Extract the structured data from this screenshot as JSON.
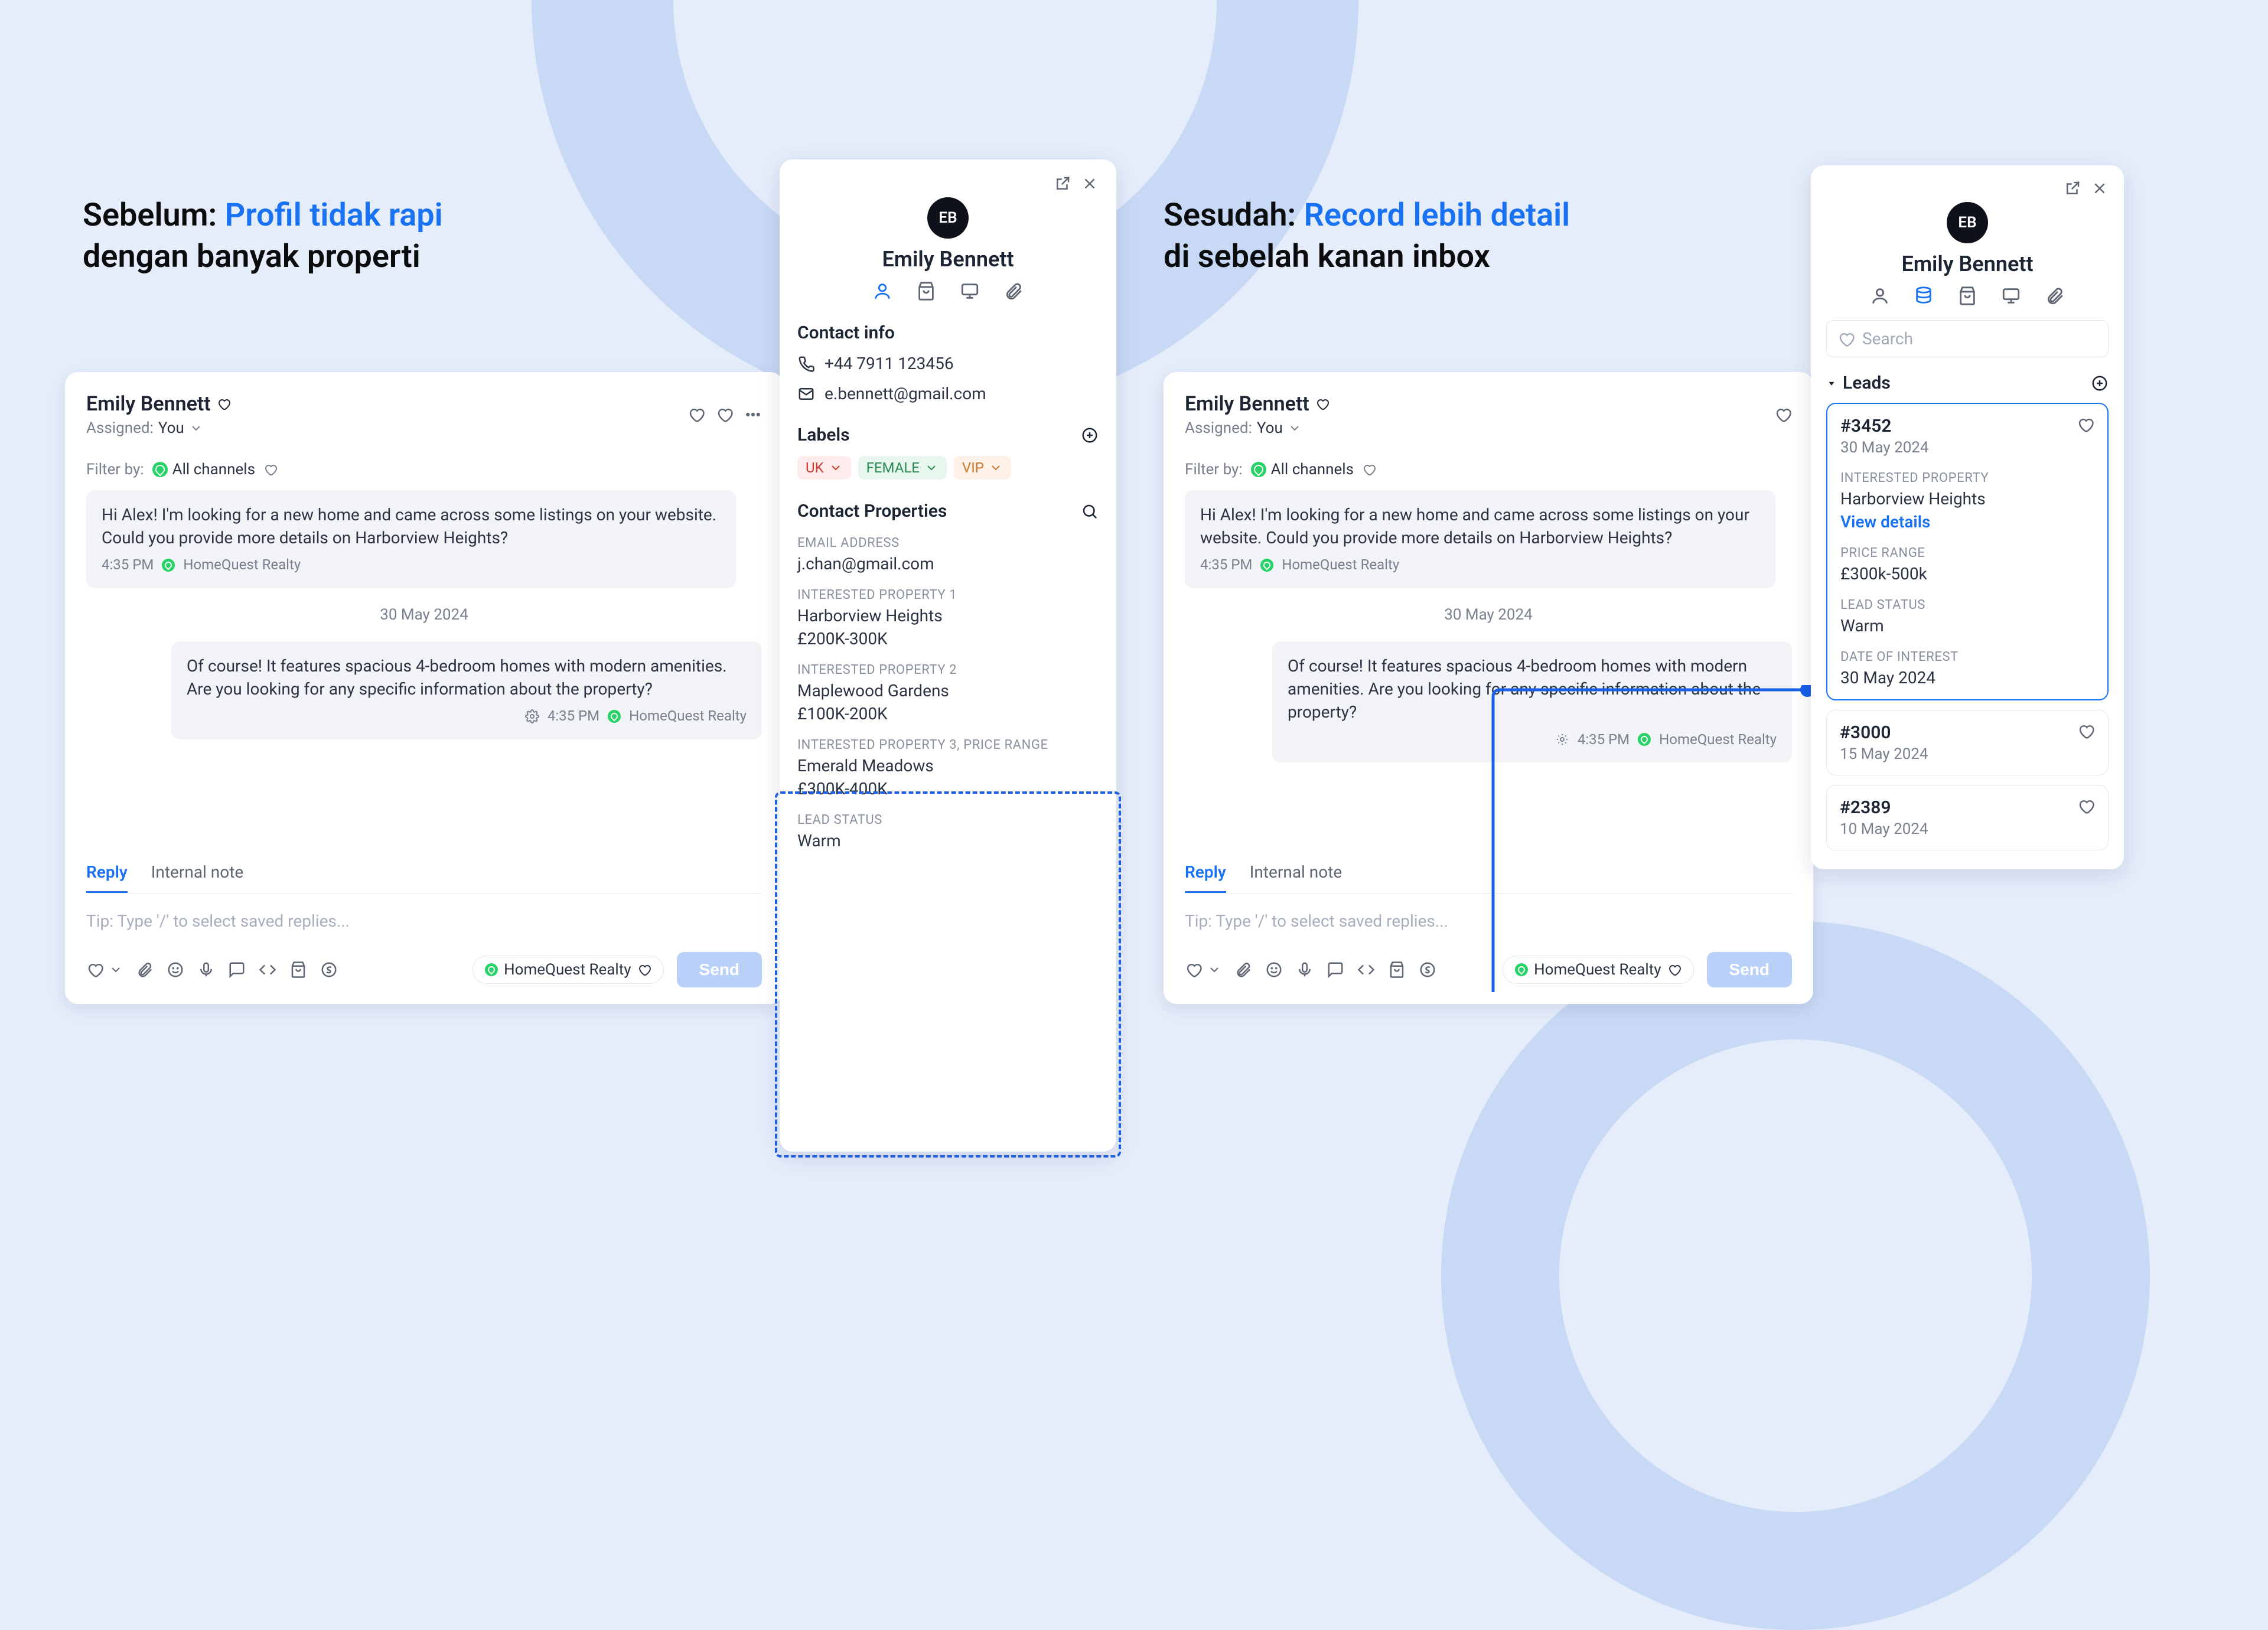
{
  "before": {
    "heading_plain": "Sebelum: ",
    "heading_accent": "Profil tidak rapi",
    "heading_line2": "dengan banyak properti"
  },
  "after": {
    "heading_plain": "Sesudah: ",
    "heading_accent": "Record lebih detail",
    "heading_line2": "di sebelah kanan inbox"
  },
  "chat": {
    "contact_name": "Emily Bennett",
    "assigned_label": "Assigned:",
    "assigned_to": "You",
    "filter_label": "Filter by:",
    "channels_label": "All channels",
    "msg_in": "Hi Alex! I'm looking for a new home and came across some listings on your website. Could you provide more details on Harborview Heights?",
    "msg_in_time": "4:35 PM",
    "channel_name": "HomeQuest Realty",
    "date_separator": "30 May 2024",
    "msg_out": "Of course! It features spacious 4-bedroom homes with modern amenities. Are you looking for any specific information about the property?",
    "msg_out_time": "4:35 PM",
    "tab_reply": "Reply",
    "tab_note": "Internal note",
    "compose_placeholder": "Tip: Type '/' to select saved replies...",
    "send_label": "Send"
  },
  "profile": {
    "initials": "EB",
    "name": "Emily Bennett",
    "contact_info_label": "Contact info",
    "phone": "+44 7911 123456",
    "email": "e.bennett@gmail.com",
    "labels_label": "Labels",
    "label_uk": "UK",
    "label_female": "FEMALE",
    "label_vip": "VIP",
    "contact_properties_label": "Contact Properties",
    "email_field_label": "EMAIL ADDRESS",
    "email_field_value": "j.chan@gmail.com",
    "ip1_label": "INTERESTED PROPERTY 1",
    "ip1_name": "Harborview Heights",
    "ip1_price": "£200K-300K",
    "ip2_label": "INTERESTED PROPERTY 2",
    "ip2_name": "Maplewood Gardens",
    "ip2_price": "£100K-200K",
    "ip3_label": "INTERESTED PROPERTY 3, PRICE RANGE",
    "ip3_name": "Emerald Meadows",
    "ip3_price": "£300K-400K",
    "lead_status_label": "LEAD STATUS",
    "lead_status_value": "Warm"
  },
  "leads": {
    "search_placeholder": "Search",
    "section_label": "Leads",
    "selected": {
      "id": "#3452",
      "date": "30 May 2024",
      "ip_label": "INTERESTED PROPERTY",
      "ip_value": "Harborview Heights",
      "view_details": "View details",
      "price_label": "PRICE RANGE",
      "price_value": "£300k-500k",
      "status_label": "LEAD STATUS",
      "status_value": "Warm",
      "doi_label": "DATE OF INTEREST",
      "doi_value": "30 May 2024"
    },
    "card2": {
      "id": "#3000",
      "date": "15 May 2024"
    },
    "card3": {
      "id": "#2389",
      "date": "10 May 2024"
    }
  }
}
